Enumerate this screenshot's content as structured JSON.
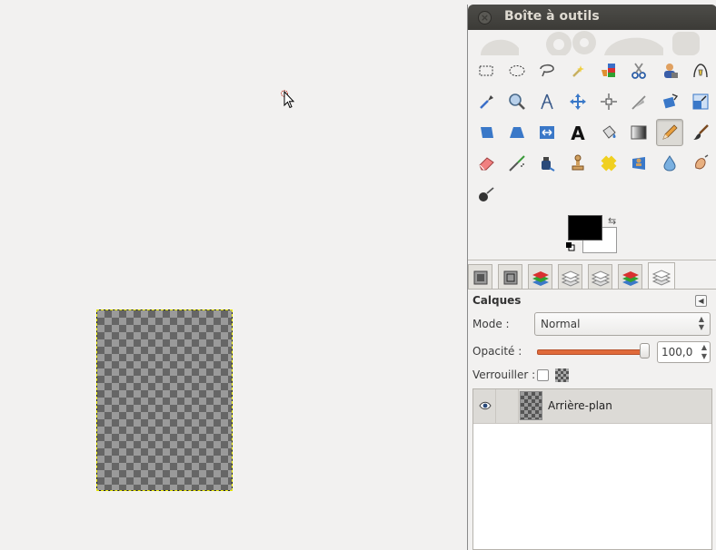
{
  "toolbox": {
    "title": "Boîte à outils",
    "tools": [
      {
        "name": "rect-select-icon"
      },
      {
        "name": "ellipse-select-icon"
      },
      {
        "name": "free-select-icon"
      },
      {
        "name": "fuzzy-select-icon"
      },
      {
        "name": "color-select-icon"
      },
      {
        "name": "scissors-select-icon"
      },
      {
        "name": "foreground-select-icon"
      },
      {
        "name": "paths-icon"
      },
      {
        "name": "color-picker-icon"
      },
      {
        "name": "zoom-icon"
      },
      {
        "name": "measure-icon"
      },
      {
        "name": "move-icon"
      },
      {
        "name": "align-icon"
      },
      {
        "name": "crop-icon"
      },
      {
        "name": "rotate-icon"
      },
      {
        "name": "scale-icon"
      },
      {
        "name": "shear-icon"
      },
      {
        "name": "perspective-icon"
      },
      {
        "name": "flip-icon"
      },
      {
        "name": "text-icon"
      },
      {
        "name": "bucket-fill-icon"
      },
      {
        "name": "blend-icon"
      },
      {
        "name": "pencil-icon",
        "active": true
      },
      {
        "name": "paintbrush-icon"
      },
      {
        "name": "eraser-icon"
      },
      {
        "name": "airbrush-icon"
      },
      {
        "name": "ink-icon"
      },
      {
        "name": "clone-icon"
      },
      {
        "name": "heal-icon"
      },
      {
        "name": "perspective-clone-icon"
      },
      {
        "name": "blur-sharpen-icon"
      },
      {
        "name": "smudge-icon"
      },
      {
        "name": "dodge-burn-icon"
      }
    ],
    "foreground_color": "#000000",
    "background_color": "#ffffff"
  },
  "dock": {
    "tabs": [
      "tool-options-tab",
      "device-status-tab",
      "layers-tab-red",
      "channels-tab",
      "paths-tab",
      "undo-tab",
      "layers-tab"
    ],
    "panel_title": "Calques",
    "mode_label": "Mode :",
    "mode_value": "Normal",
    "opacity_label": "Opacité :",
    "opacity_value": "100,0",
    "opacity_level": 1.0,
    "lock_label": "Verrouiller :",
    "layers": [
      {
        "name": "Arrière-plan",
        "visible": true
      }
    ]
  }
}
